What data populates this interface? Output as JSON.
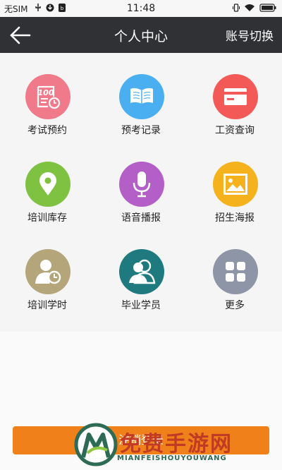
{
  "status_bar": {
    "carrier": "无SIM",
    "time": "11:48"
  },
  "app_bar": {
    "title": "个人中心",
    "switch_label": "账号切换",
    "back_icon": "arrow-left-icon"
  },
  "grid": {
    "items": [
      {
        "label": "考试预约",
        "color": "#f07a8a",
        "icon": "exam-appointment-icon"
      },
      {
        "label": "预考记录",
        "color": "#4aaff0",
        "icon": "book-icon"
      },
      {
        "label": "工资查询",
        "color": "#f35a57",
        "icon": "card-icon"
      },
      {
        "label": "培训库存",
        "color": "#7fc242",
        "icon": "location-pin-icon"
      },
      {
        "label": "语音播报",
        "color": "#b45ec8",
        "icon": "microphone-icon"
      },
      {
        "label": "招生海报",
        "color": "#f6b21c",
        "icon": "picture-icon"
      },
      {
        "label": "培训学时",
        "color": "#b5a57a",
        "icon": "user-clock-icon"
      },
      {
        "label": "毕业学员",
        "color": "#1e7a7e",
        "icon": "users-icon"
      },
      {
        "label": "更多",
        "color": "#8d95a7",
        "icon": "more-grid-icon"
      }
    ]
  },
  "logout_button": {
    "label": "注销登录"
  },
  "watermark": {
    "text": "免费手游网",
    "sub": "MIANFEISHOUYOUWANG"
  }
}
